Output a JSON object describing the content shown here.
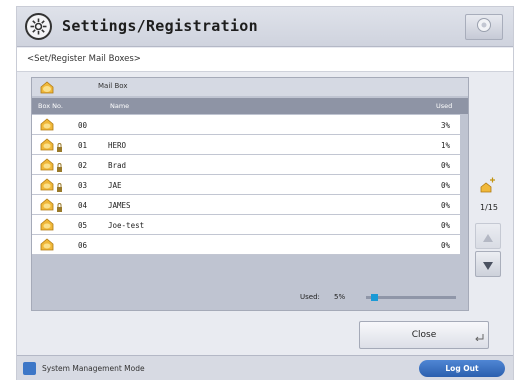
{
  "header": {
    "title": "Settings/Registration",
    "icon": "settings-gear-icon",
    "home_icon": "home-icon"
  },
  "subtitle": "<Set/Register Mail Boxes>",
  "mailbox": {
    "label": "Mail Box",
    "columns": {
      "box_no": "Box No.",
      "name": "Name",
      "used": "Used"
    },
    "rows": [
      {
        "num": "00",
        "name": "",
        "used": "3%",
        "locked": false
      },
      {
        "num": "01",
        "name": "HERO",
        "used": "1%",
        "locked": true
      },
      {
        "num": "02",
        "name": "Brad",
        "used": "0%",
        "locked": true
      },
      {
        "num": "03",
        "name": "JAE",
        "used": "0%",
        "locked": true
      },
      {
        "num": "04",
        "name": "JAMES",
        "used": "0%",
        "locked": true
      },
      {
        "num": "05",
        "name": "Joe-test",
        "used": "0%",
        "locked": false
      },
      {
        "num": "06",
        "name": "",
        "used": "0%",
        "locked": false
      }
    ],
    "used_label": "Used:",
    "used_value": "5%",
    "used_fraction": 0.05
  },
  "pager": {
    "page": "1/15"
  },
  "buttons": {
    "close": "Close"
  },
  "footer": {
    "mode_label": "System Management Mode",
    "logout": "Log Out"
  }
}
